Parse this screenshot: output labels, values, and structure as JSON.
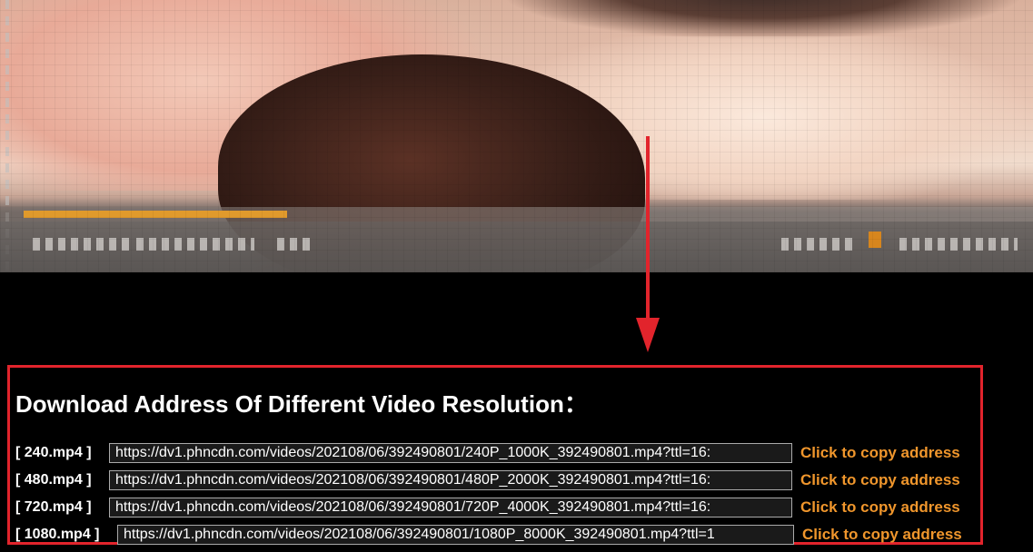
{
  "download": {
    "title": "Download Address Of Different Video Resolution：",
    "rows": [
      {
        "label": "[ 240.mp4 ]",
        "url": "https://dv1.phncdn.com/videos/202108/06/392490801/240P_1000K_392490801.mp4?ttl=16:",
        "copy": "Click to copy address"
      },
      {
        "label": "[ 480.mp4 ]",
        "url": "https://dv1.phncdn.com/videos/202108/06/392490801/480P_2000K_392490801.mp4?ttl=16:",
        "copy": "Click to copy address"
      },
      {
        "label": "[ 720.mp4 ]",
        "url": "https://dv1.phncdn.com/videos/202108/06/392490801/720P_4000K_392490801.mp4?ttl=16:",
        "copy": "Click to copy address"
      },
      {
        "label": "[ 1080.mp4 ]",
        "url": "https://dv1.phncdn.com/videos/202108/06/392490801/1080P_8000K_392490801.mp4?ttl=1",
        "copy": "Click to copy address"
      }
    ]
  },
  "colors": {
    "panel_border": "#e2242c",
    "arrow": "#e2242c",
    "copy_link": "#f0962c",
    "background": "#000000"
  },
  "icons": {
    "arrow": "down-arrow-icon"
  }
}
